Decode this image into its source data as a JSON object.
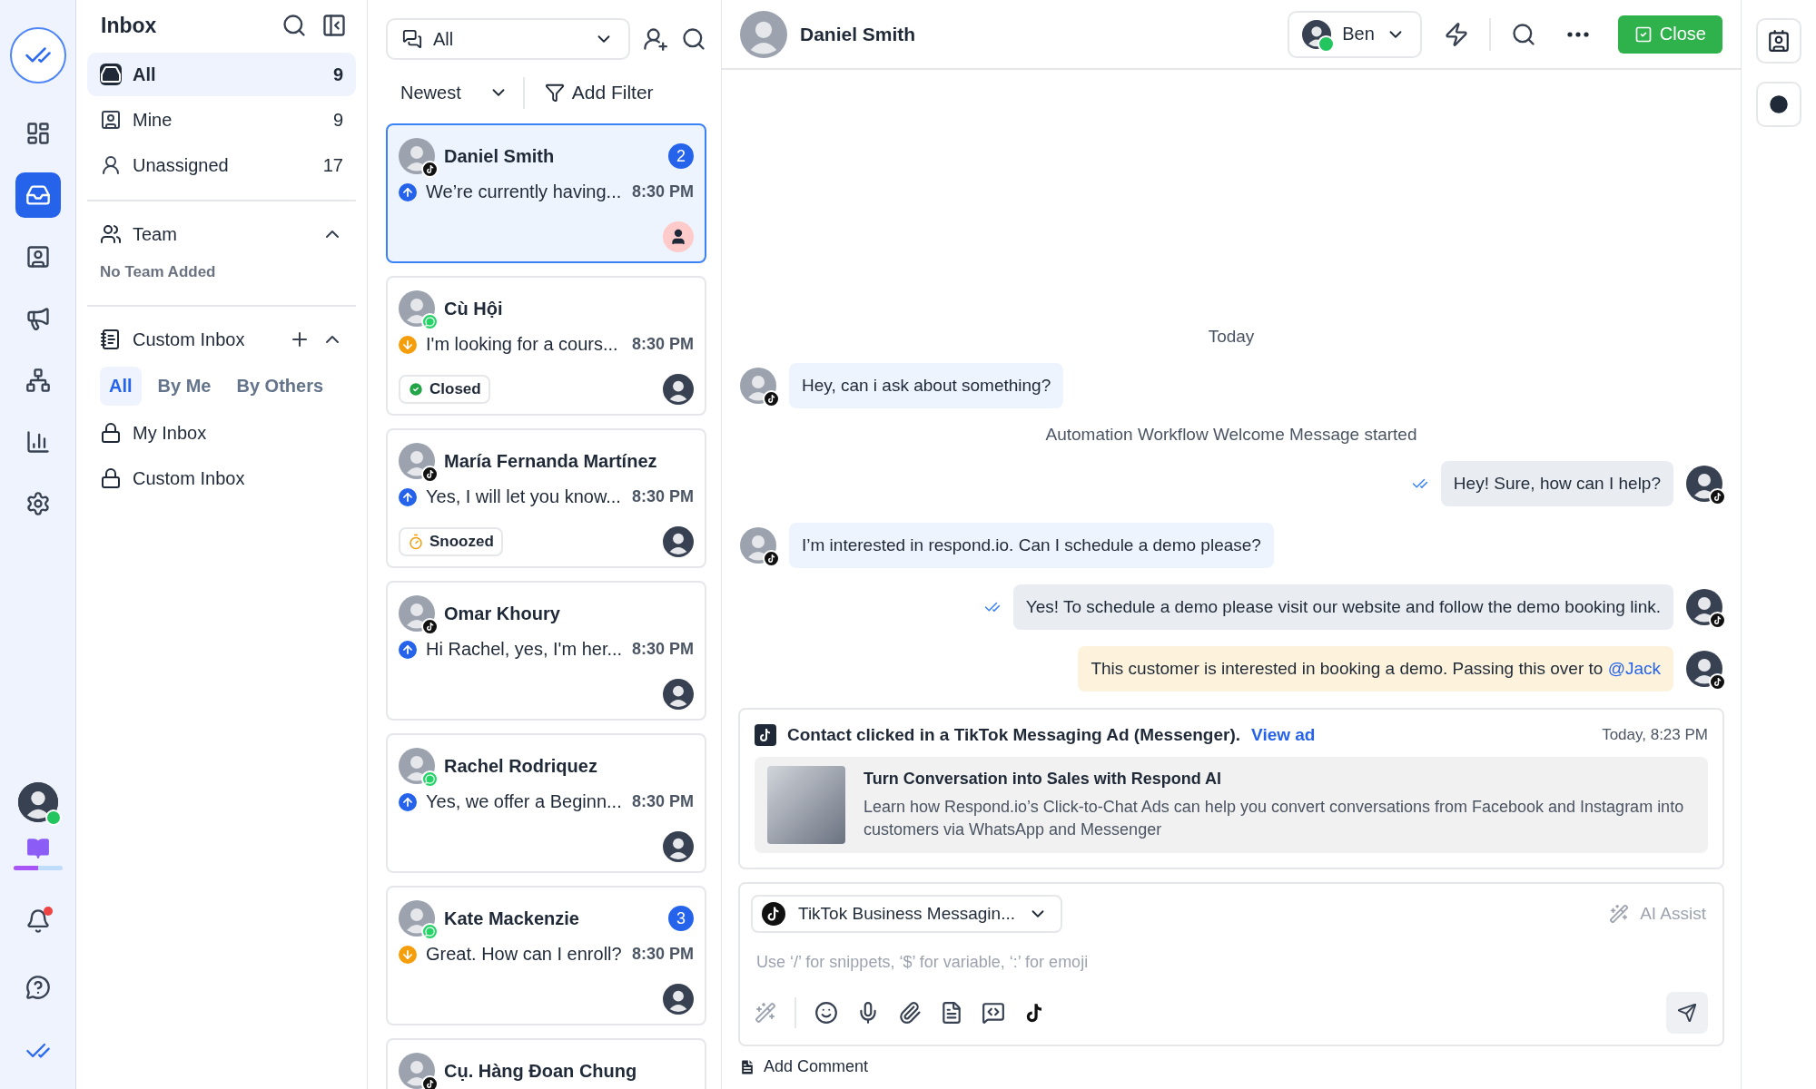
{
  "rail": {
    "items": [
      {
        "kind": "dashboard",
        "selected": false
      },
      {
        "kind": "inbox",
        "selected": true
      },
      {
        "kind": "contacts",
        "selected": false
      },
      {
        "kind": "broadcasts",
        "selected": false
      },
      {
        "kind": "workflows",
        "selected": false
      },
      {
        "kind": "reports",
        "selected": false
      },
      {
        "kind": "settings",
        "selected": false
      }
    ],
    "user": {
      "online": true
    },
    "guide": {
      "level": 0.5
    },
    "notifications": {
      "unread": true
    }
  },
  "sidebar": {
    "title": "Inbox",
    "folders": [
      {
        "kind": "all",
        "label": "All",
        "count": "9",
        "selected": true
      },
      {
        "kind": "mine",
        "label": "Mine",
        "count": "9",
        "selected": false
      },
      {
        "kind": "unassigned",
        "label": "Unassigned",
        "count": "17",
        "selected": false
      }
    ],
    "team": {
      "title": "Team",
      "expanded": true,
      "empty": "No Team Added"
    },
    "custom": {
      "title": "Custom Inbox",
      "expanded": true,
      "filters": [
        {
          "label": "All",
          "selected": true
        },
        {
          "label": "By Me",
          "selected": false
        },
        {
          "label": "By Others",
          "selected": false
        }
      ],
      "items": [
        {
          "label": "My Inbox"
        },
        {
          "label": "Custom Inbox"
        }
      ]
    }
  },
  "list": {
    "filter": "All",
    "sort": "Newest",
    "add_filter": "Add Filter",
    "conversations": [
      {
        "name": "Daniel Smith",
        "whatsapp": false,
        "outgoing": true,
        "preview": "We’re currently having...",
        "time": "8:30 PM",
        "unread": "2",
        "assigned": false,
        "selected": true
      },
      {
        "name": "Cù Hội",
        "whatsapp": true,
        "outgoing": false,
        "preview": "I'm looking for a cours...",
        "time": "8:30 PM",
        "status": {
          "kind": "closed",
          "label": "Closed"
        },
        "assigned": true,
        "selected": false
      },
      {
        "name": "María Fernanda Martínez",
        "whatsapp": false,
        "outgoing": true,
        "preview": "Yes, I will let you know...",
        "time": "8:30 PM",
        "status": {
          "kind": "snoozed",
          "label": "Snoozed"
        },
        "assigned": true,
        "selected": false
      },
      {
        "name": "Omar Khoury",
        "whatsapp": false,
        "outgoing": true,
        "preview": "Hi Rachel, yes, I'm her...",
        "time": "8:30 PM",
        "assigned": true,
        "selected": false
      },
      {
        "name": "Rachel Rodriquez",
        "whatsapp": true,
        "outgoing": true,
        "preview": "Yes, we offer a Beginn...",
        "time": "8:30 PM",
        "assigned": true,
        "selected": false
      },
      {
        "name": "Kate Mackenzie",
        "whatsapp": true,
        "outgoing": false,
        "preview": "Great. How can I enroll?",
        "time": "8:30 PM",
        "unread": "3",
        "assigned": true,
        "selected": false
      },
      {
        "name": "Cụ. Hàng Đoan Chung",
        "whatsapp": false,
        "selected": false
      }
    ]
  },
  "chat": {
    "contact": "Daniel Smith",
    "assignee": {
      "name": "Ben",
      "online": true
    },
    "close": "Close",
    "messages": [
      {
        "kind": "date",
        "text": "Today"
      },
      {
        "kind": "incoming",
        "text": "Hey, can i ask about something?"
      },
      {
        "kind": "system",
        "text": "Automation Workflow Welcome Message started"
      },
      {
        "kind": "outgoing",
        "text": "Hey! Sure, how can I help?",
        "read": true
      },
      {
        "kind": "incoming",
        "text": "I’m interested in respond.io. Can I schedule a demo please?"
      },
      {
        "kind": "outgoing",
        "text": "Yes! To schedule a demo please visit our website and follow the demo booking link.",
        "read": true
      },
      {
        "kind": "note",
        "text": "This customer is interested in booking a demo. Passing this over to",
        "mention": "@Jack"
      }
    ],
    "ad": {
      "title": "Contact clicked in a TikTok Messaging Ad (Messenger).",
      "link": "View ad",
      "time": "Today, 8:23 PM",
      "headline": "Turn Conversation into Sales with Respond AI",
      "body": "Learn how Respond.io’s Click-to-Chat Ads can help you convert conversations from Facebook and Instagram into customers via WhatsApp and Messenger"
    },
    "composer": {
      "channel": "TikTok Business Messagin...",
      "ai": "AI Assist",
      "placeholder": "Use ‘/’ for snippets, ‘$’ for variable, ‘:’ for emoji"
    },
    "comment": "Add Comment"
  }
}
